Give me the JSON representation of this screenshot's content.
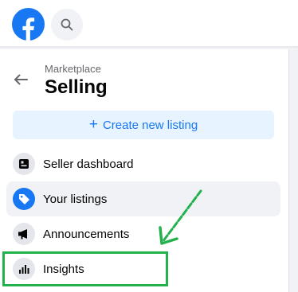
{
  "header": {
    "logo_icon": "facebook-logo-icon",
    "search_icon": "search-icon"
  },
  "sidebar": {
    "back_icon": "arrow-left-icon",
    "subtitle": "Marketplace",
    "title": "Selling",
    "create_button": {
      "icon": "plus-icon",
      "label": "Create new listing"
    },
    "items": [
      {
        "label": "Seller dashboard",
        "icon": "dashboard-icon",
        "active": false
      },
      {
        "label": "Your listings",
        "icon": "tag-icon",
        "active": true
      },
      {
        "label": "Announcements",
        "icon": "megaphone-icon",
        "active": false
      },
      {
        "label": "Insights",
        "icon": "bar-chart-icon",
        "active": false
      }
    ]
  },
  "annotation": {
    "color": "#22b14c",
    "target": "Insights"
  },
  "colors": {
    "brand": "#1877f2",
    "create_bg": "#e7f3ff",
    "active_bg": "#f0f2f5",
    "icon_bg": "#e4e6eb"
  }
}
